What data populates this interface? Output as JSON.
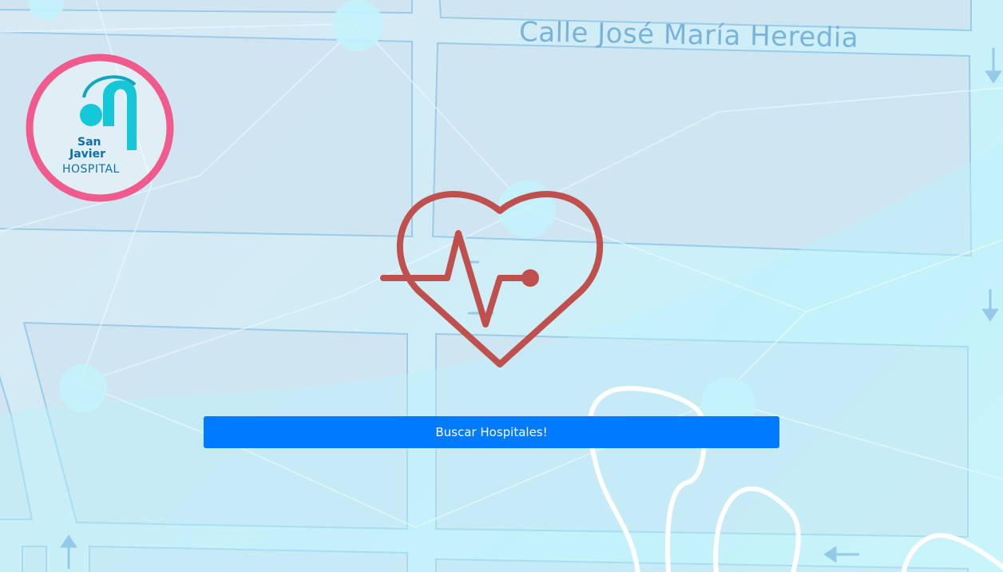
{
  "background": {
    "street_label": "Calle José María Heredia"
  },
  "logo": {
    "line1": "San",
    "line2": "Javier",
    "line3": "HOSPITAL",
    "ring_color": "#f05a8c",
    "mark_color": "#14c7d9",
    "text_color": "#0d6fae"
  },
  "heart_icon": {
    "name": "heartbeat-icon",
    "color": "#c0504d"
  },
  "search_button": {
    "label": "Buscar Hospitales!",
    "color": "#007bff"
  }
}
